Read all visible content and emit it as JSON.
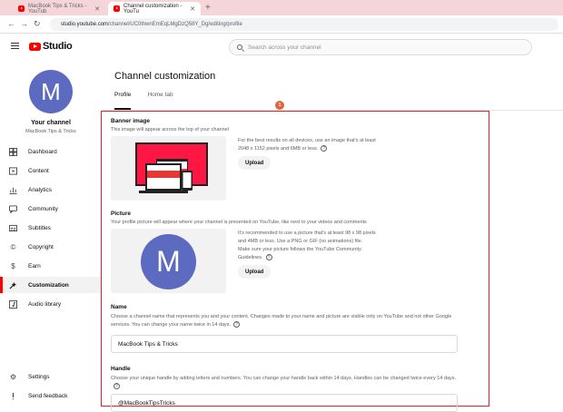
{
  "browser": {
    "tabs": [
      {
        "label": "MacBook Tips & Tricks - YouTub",
        "active": false
      },
      {
        "label": "Channel customization - YouTu",
        "active": true
      }
    ],
    "new_tab": "+",
    "url_domain": "studio.youtube.com",
    "url_path": "/channel/UC0lhwnEmEqLMgDzQ58Y_Dg/editing/profile"
  },
  "header": {
    "logo_text": "Studio",
    "search_placeholder": "Search across your channel"
  },
  "sidebar": {
    "avatar_letter": "M",
    "channel_label": "Your channel",
    "channel_name": "MacBook Tips & Tricks",
    "items": [
      {
        "label": "Dashboard",
        "icon": "dashboard-icon"
      },
      {
        "label": "Content",
        "icon": "content-icon"
      },
      {
        "label": "Analytics",
        "icon": "analytics-icon"
      },
      {
        "label": "Community",
        "icon": "community-icon"
      },
      {
        "label": "Subtitles",
        "icon": "subtitles-icon"
      },
      {
        "label": "Copyright",
        "icon": "copyright-icon"
      },
      {
        "label": "Earn",
        "icon": "earn-icon"
      },
      {
        "label": "Customization",
        "icon": "customization-icon",
        "active": true
      },
      {
        "label": "Audio library",
        "icon": "audio-library-icon"
      }
    ],
    "bottom": [
      {
        "label": "Settings",
        "icon": "settings-icon"
      },
      {
        "label": "Send feedback",
        "icon": "feedback-icon"
      }
    ]
  },
  "main": {
    "title": "Channel customization",
    "tabs": [
      {
        "label": "Profile",
        "active": true
      },
      {
        "label": "Home tab",
        "active": false
      }
    ],
    "step_badge": "1",
    "banner": {
      "heading": "Banner image",
      "desc": "This image will appear across the top of your channel",
      "info": "For the best results on all devices, use an image that's at least 2048 x 1152 pixels and 6MB or less.",
      "button": "Upload"
    },
    "picture": {
      "heading": "Picture",
      "desc": "Your profile picture will appear where your channel is presented on YouTube, like next to your videos and comments",
      "avatar_letter": "M",
      "info": "It's recommended to use a picture that's at least 98 x 98 pixels and 4MB or less. Use a PNG or GIF (no animations) file. Make sure your picture follows the YouTube Community Guidelines.",
      "button": "Upload"
    },
    "name": {
      "heading": "Name",
      "desc": "Choose a channel name that represents you and your content. Changes made to your name and picture are visible only on YouTube and not other Google services. You can change your name twice in 14 days.",
      "value": "MacBook Tips & Tricks"
    },
    "handle": {
      "heading": "Handle",
      "desc": "Choose your unique handle by adding letters and numbers. You can change your handle back within 14 days. Handles can be changed twice every 14 days.",
      "value": "@MacBookTipsTricks"
    }
  },
  "colors": {
    "accent_red": "#ff0000",
    "highlight_border": "#e3202f",
    "avatar": "#5c6bc0",
    "badge": "#e8633b"
  }
}
